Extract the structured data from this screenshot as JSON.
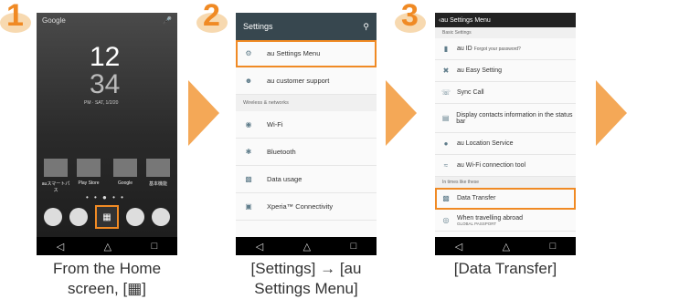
{
  "steps": [
    {
      "number": "1",
      "caption_line1": "From the Home",
      "caption_line2": "screen, [▦]"
    },
    {
      "number": "2",
      "caption_line1": "[Settings] → [au",
      "caption_line2": "Settings Menu]"
    },
    {
      "number": "3",
      "caption_line1": "[Data Transfer]",
      "caption_line2": ""
    }
  ],
  "phone1": {
    "search_label": "Google",
    "clock_hours": "12",
    "clock_minutes": "34",
    "date": "PM · SAT, 1/2/20",
    "apps": [
      {
        "label": "auスマートパス"
      },
      {
        "label": "Play Store"
      },
      {
        "label": "Google"
      },
      {
        "label": "基本機能"
      }
    ],
    "apps_button": "▦"
  },
  "phone2": {
    "title": "Settings",
    "search_icon": "search-icon",
    "items_top": [
      {
        "label": "au Settings Menu",
        "icon": "gear-icon"
      },
      {
        "label": "au customer support",
        "icon": "person-icon"
      }
    ],
    "section": "Wireless & networks",
    "items": [
      {
        "label": "Wi-Fi",
        "icon": "wifi-icon"
      },
      {
        "label": "Bluetooth",
        "icon": "bluetooth-icon"
      },
      {
        "label": "Data usage",
        "icon": "bar-chart-icon"
      },
      {
        "label": "Xperia™ Connectivity",
        "icon": "connectivity-icon"
      }
    ]
  },
  "phone3": {
    "title": "au Settings Menu",
    "section1": "Basic Settings",
    "items": [
      {
        "label": "au ID",
        "sub": "Forgot your password?"
      },
      {
        "label": "au Easy Setting",
        "sub": ""
      },
      {
        "label": "Sync Call",
        "sub": ""
      },
      {
        "label": "Display contacts information in the status bar",
        "sub": ""
      },
      {
        "label": "au Location Service",
        "sub": ""
      },
      {
        "label": "au Wi-Fi connection tool",
        "sub": ""
      }
    ],
    "section2": "In times like these",
    "items2": [
      {
        "label": "Data Transfer",
        "sub": ""
      },
      {
        "label": "When travelling abroad",
        "sub": "GLOBAL PASSPORT"
      }
    ]
  },
  "navbar": {
    "back": "◁",
    "home": "△",
    "recent": "□"
  }
}
